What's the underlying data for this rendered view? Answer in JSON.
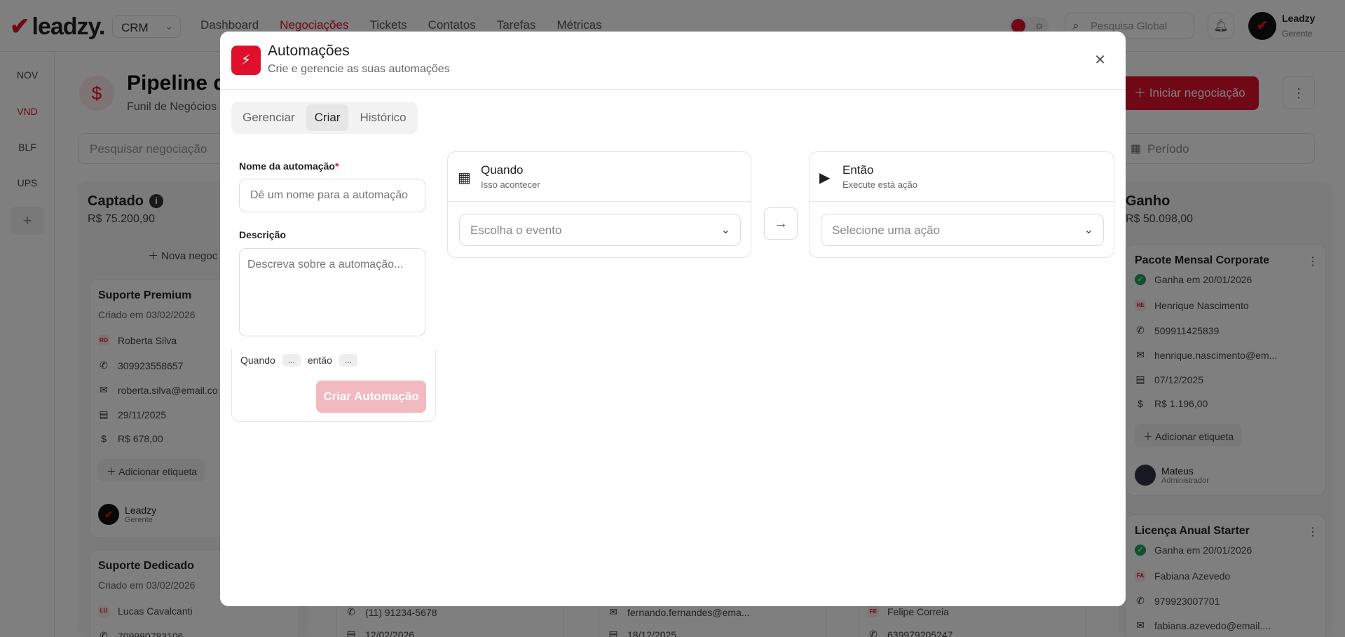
{
  "app": {
    "logo": "leadzy.",
    "workspace_select": "CRM",
    "nav": [
      "Dashboard",
      "Negociações",
      "Tickets",
      "Contatos",
      "Tarefas",
      "Métricas"
    ],
    "global_search_placeholder": "Pesquisa Global",
    "user": {
      "name": "Leadzy",
      "role": "Gerente"
    }
  },
  "sidebar": {
    "items": [
      {
        "label": "NOV"
      },
      {
        "label": "VND"
      },
      {
        "label": "BLF"
      },
      {
        "label": "UPS"
      }
    ],
    "add_label": "+"
  },
  "page": {
    "title": "Pipeline d",
    "subtitle": "Funil de Negócios",
    "search_placeholder": "Pesquisar negociação",
    "start_deal_label": "Iniciar negociação",
    "period_label": "Período"
  },
  "columns": {
    "captado": {
      "title": "Captado",
      "total": "R$ 75.200,90",
      "new_deal": "Nova negoc",
      "cards": [
        {
          "title": "Suporte Premium",
          "created": "Criado em 03/02/2026",
          "initials": "RO",
          "contact": "Roberta Silva",
          "phone": "309923558657",
          "email": "roberta.silva@email.co",
          "date": "29/11/2025",
          "amount": "R$ 678,00",
          "tag_label": "Adicionar etiqueta",
          "owner": "Leadzy",
          "owner_role": "Gerente"
        },
        {
          "title": "Suporte Dedicado",
          "created": "Criado em 03/02/2026",
          "initials": "LU",
          "contact": "Lucas Cavalcanti",
          "phone": "709980783106"
        }
      ]
    },
    "middle_rows": {
      "phone_a": "(11) 91234-5678",
      "date_a": "12/02/2026",
      "email_b": "fernando.fernandes@ema...",
      "date_b": "18/12/2025",
      "initials_c": "FE",
      "contact_c": "Felipe Correia",
      "phone_c": "639979205247"
    },
    "ganho": {
      "title": "Ganho",
      "total": "R$ 50.098,00",
      "cards": [
        {
          "title": "Pacote Mensal Corporate",
          "won": "Ganha em 20/01/2026",
          "initials": "HE",
          "contact": "Henrique Nascimento",
          "phone": "509911425839",
          "email": "henrique.nascimento@em...",
          "date": "07/12/2025",
          "amount": "R$ 1.196,00",
          "tag_label": "Adicionar etiqueta",
          "owner": "Mateus",
          "owner_role": "Administrador"
        },
        {
          "title": "Licença Anual Starter",
          "won": "Ganha em 20/01/2026",
          "initials": "FA",
          "contact": "Fabiana Azevedo",
          "phone": "979923007701",
          "email": "fabiana.azevedo@email...."
        }
      ]
    }
  },
  "modal": {
    "title": "Automações",
    "subtitle": "Crie e gerencie as suas automações",
    "tabs": [
      {
        "label": "Gerenciar"
      },
      {
        "label": "Criar"
      },
      {
        "label": "Histórico"
      }
    ],
    "active_tab": "Criar",
    "form": {
      "name_label": "Nome da automação",
      "required_mark": "*",
      "name_placeholder": "Dê um nome para a automação",
      "desc_label": "Descrição",
      "desc_placeholder": "Descreva sobre a automação...",
      "summary_when": "Quando",
      "summary_chip_1": "...",
      "summary_then": "então",
      "summary_chip_2": "...",
      "submit_label": "Criar Automação"
    },
    "when": {
      "title": "Quando",
      "subtitle": "Isso acontecer",
      "select_placeholder": "Escolha o evento"
    },
    "then": {
      "title": "Então",
      "subtitle": "Execute está ação",
      "select_placeholder": "Selecione uma ação"
    }
  },
  "colors": {
    "brand": "#e0102d",
    "overlay": "rgba(0,0,0,0.5)",
    "success": "#22a35a"
  }
}
